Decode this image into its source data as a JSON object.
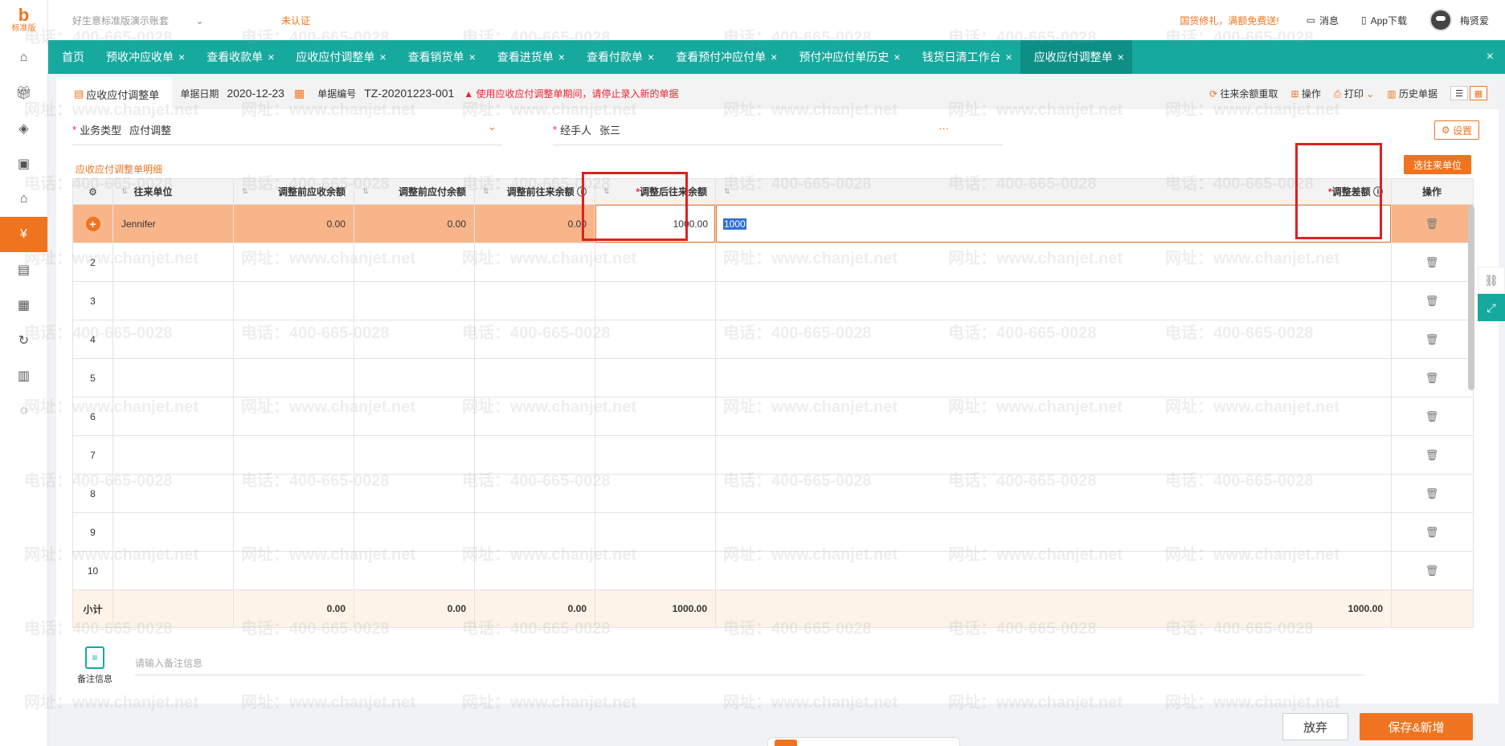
{
  "brand": {
    "mark": "b",
    "label": "标准版"
  },
  "sidebar": {
    "icons": [
      "home-icon",
      "gift-icon",
      "box-icon",
      "bag-icon",
      "warehouse-icon",
      "finance-icon",
      "clipboard-icon",
      "report-icon",
      "cycle-icon",
      "news-icon",
      "chat-icon"
    ],
    "active_index": 5
  },
  "topbar": {
    "account": "好生意标准版演示账套",
    "unverified": "未认证",
    "promo": "国货修礼，满额免费送!",
    "messages": "消息",
    "app_download": "App下载",
    "username": "梅贤爱"
  },
  "tabs": [
    {
      "label": "首页",
      "closable": false
    },
    {
      "label": "预收冲应收单",
      "closable": true
    },
    {
      "label": "查看收款单",
      "closable": true
    },
    {
      "label": "应收应付调整单",
      "closable": true
    },
    {
      "label": "查看销货单",
      "closable": true
    },
    {
      "label": "查看进货单",
      "closable": true
    },
    {
      "label": "查看付款单",
      "closable": true
    },
    {
      "label": "查看预付冲应付单",
      "closable": true
    },
    {
      "label": "预付冲应付单历史",
      "closable": true
    },
    {
      "label": "钱货日清工作台",
      "closable": true
    },
    {
      "label": "应收应付调整单",
      "closable": true,
      "active": true
    }
  ],
  "doc": {
    "tab_label": "应收应付调整单",
    "date_label": "单据日期",
    "date_value": "2020-12-23",
    "number_label": "单据编号",
    "number_value": "TZ-20201223-001",
    "warning": "使用应收应付调整单期间，请停止录入新的单据",
    "actions": {
      "balance_fetch": "往来余额重取",
      "operate": "操作",
      "print": "打印",
      "history": "历史单据"
    }
  },
  "form": {
    "business_type_label": "业务类型",
    "business_type_value": "应付调整",
    "handler_label": "经手人",
    "handler_value": "张三",
    "more": "···",
    "settings": "设置"
  },
  "section": {
    "title": "应收应付调整单明细",
    "select_partner": "选往来单位"
  },
  "table": {
    "headers": {
      "partner": "往来单位",
      "pre_receivable": "调整前应收余额",
      "pre_payable": "调整前应付余额",
      "pre_balance": "调整前往来余额",
      "post_balance": "调整后往来余额",
      "diff": "调整差额",
      "op": "操作"
    },
    "rows": [
      {
        "idx": "",
        "partner": "Jennifer",
        "pre_receivable": "0.00",
        "pre_payable": "0.00",
        "pre_balance": "0.00",
        "post_balance": "1000.00",
        "edit_value": "1000"
      },
      {
        "idx": "2"
      },
      {
        "idx": "3"
      },
      {
        "idx": "4"
      },
      {
        "idx": "5"
      },
      {
        "idx": "6"
      },
      {
        "idx": "7"
      },
      {
        "idx": "8"
      },
      {
        "idx": "9"
      },
      {
        "idx": "10"
      }
    ],
    "total": {
      "label": "小计",
      "pre_receivable": "0.00",
      "pre_payable": "0.00",
      "pre_balance": "0.00",
      "post_balance": "1000.00",
      "diff": "1000.00"
    }
  },
  "notes": {
    "label": "备注信息",
    "placeholder": "请输入备注信息"
  },
  "buttons": {
    "cancel": "放弃",
    "save_new": "保存&新增"
  },
  "watermark": {
    "phone": "电话：400-665-0028",
    "site": "网址：www.chanjet.net"
  },
  "colors": {
    "teal": "#16a99e",
    "orange": "#f0741f",
    "highlight_red": "#e02020"
  }
}
